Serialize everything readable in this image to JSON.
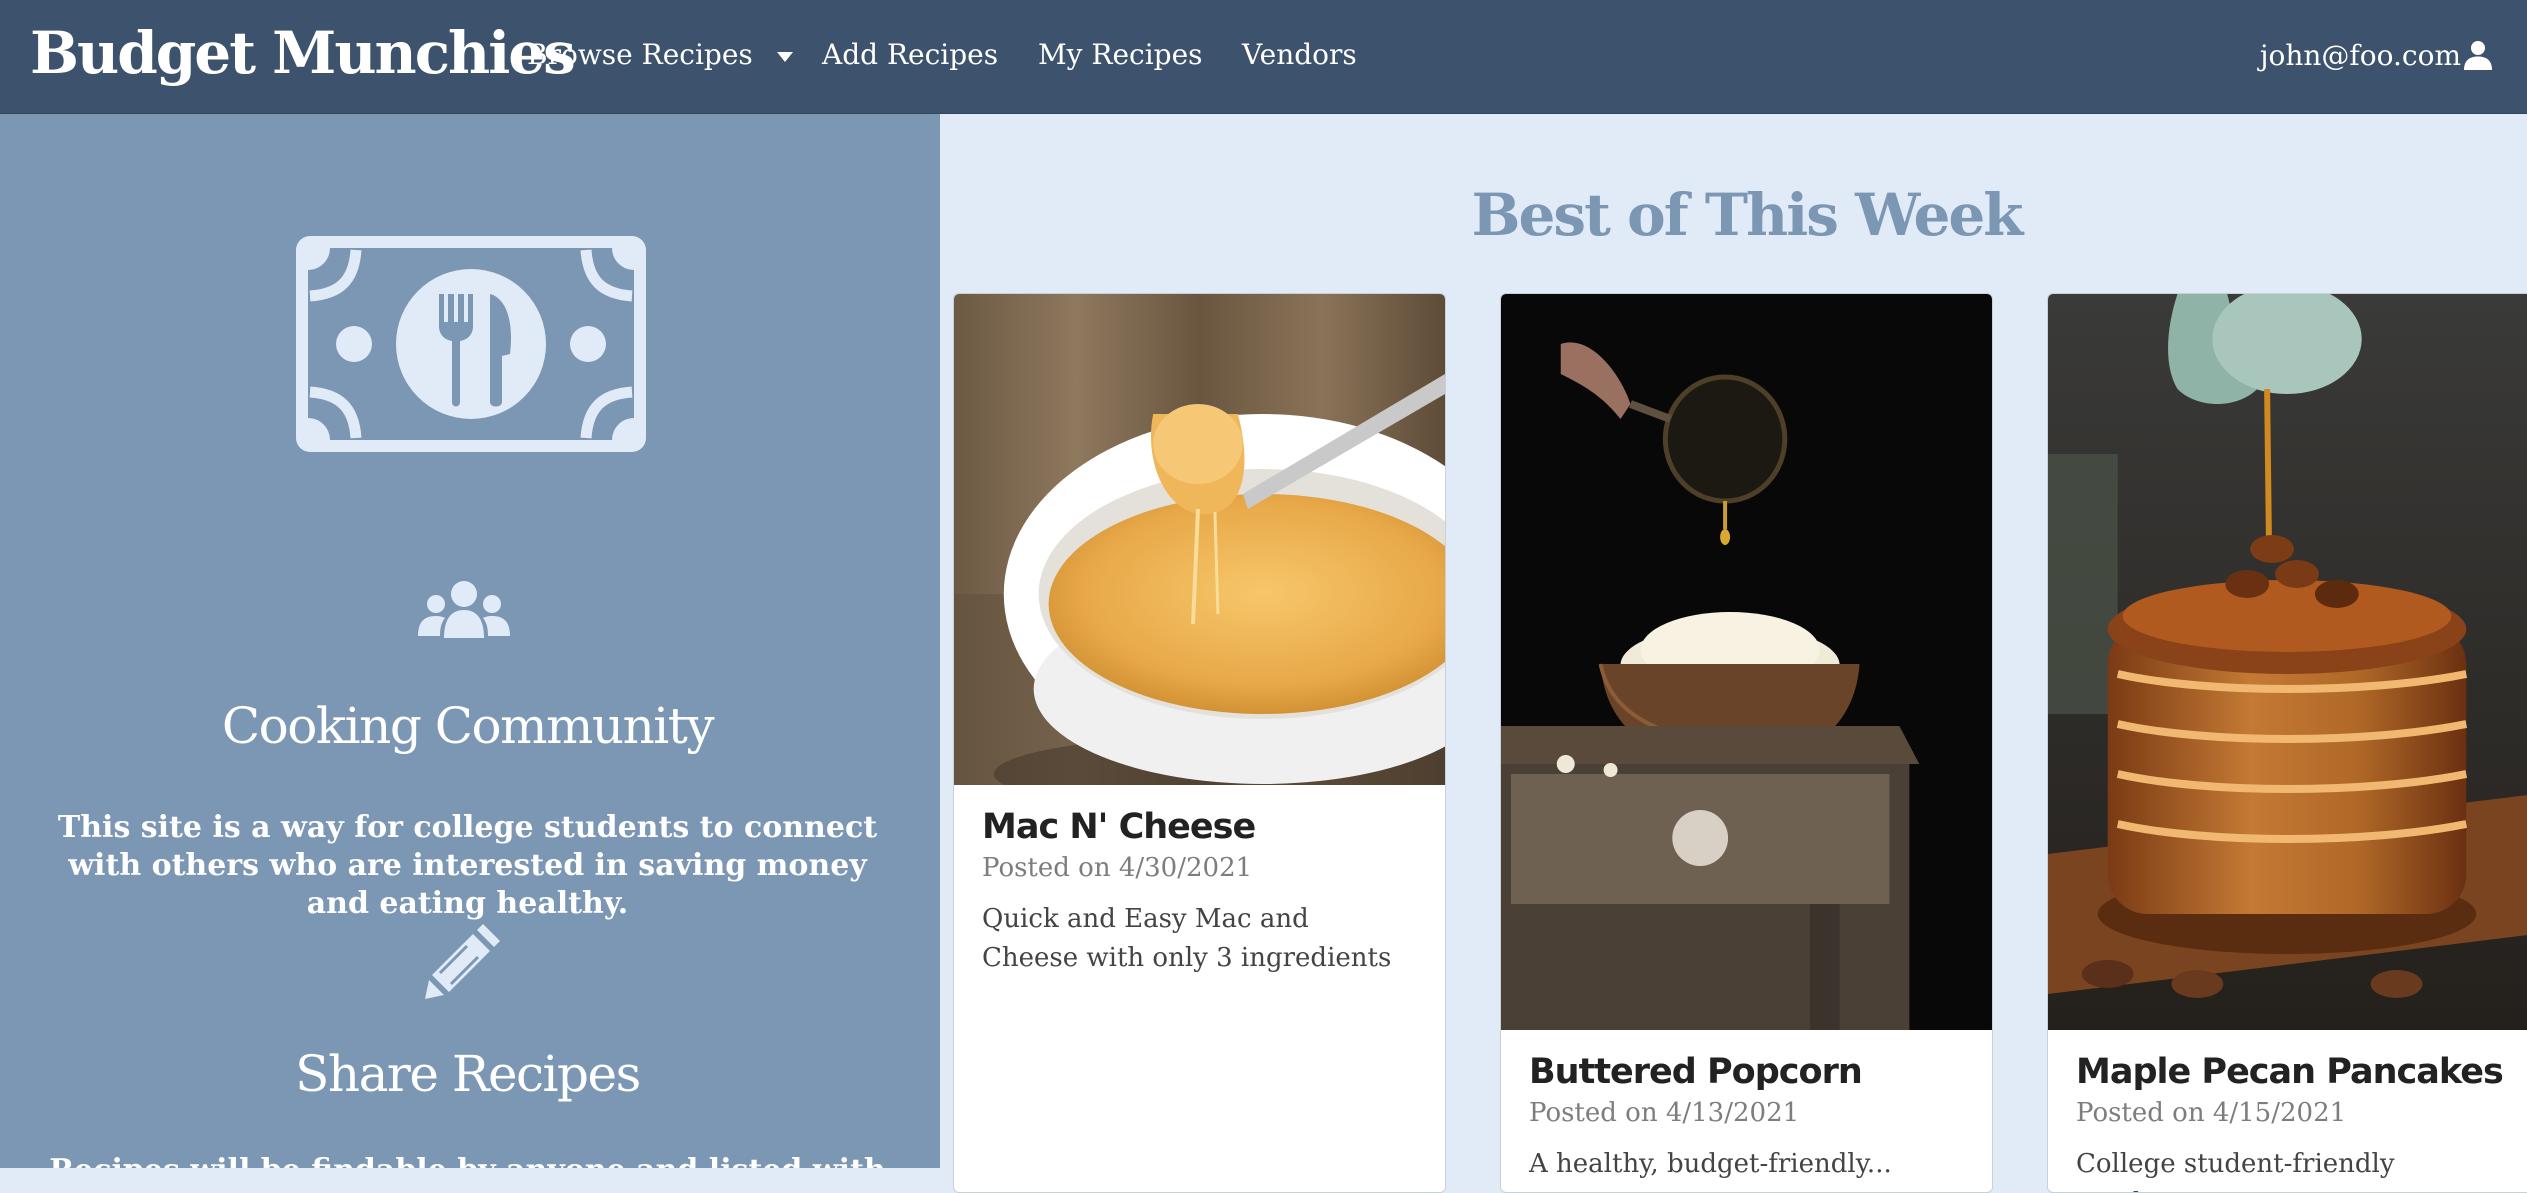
{
  "navbar": {
    "brand": "Budget Munchies",
    "links": [
      "Browse Recipes",
      "Add Recipes",
      "My Recipes",
      "Vendors"
    ],
    "user": "john@foo.com"
  },
  "sidebar": {
    "sections": [
      {
        "icon": "people-icon",
        "heading": "Cooking Community",
        "text": "This site is a way for college students to connect with others who are interested in saving money and eating healthy."
      },
      {
        "icon": "pencil-icon",
        "heading": "Share Recipes",
        "text": "Recipes will be findable by anyone and listed with their..."
      }
    ]
  },
  "main": {
    "title": "Best of This Week",
    "cards": [
      {
        "title": "Mac N' Cheese",
        "date": "Posted on 4/30/2021",
        "description": "Quick and Easy Mac and Cheese with only 3 ingredients"
      },
      {
        "title": "Buttered Popcorn",
        "date": "Posted on 4/13/2021",
        "description": "A healthy, budget-friendly..."
      },
      {
        "title": "Maple Pecan Pancakes",
        "date": "Posted on 4/15/2021",
        "description": "College student-friendly maple..."
      }
    ]
  },
  "colors": {
    "navbar": "#3d526c",
    "sidebar": "#7b97b4",
    "main_bg": "#e1eaf7",
    "title": "#7b97b4"
  }
}
